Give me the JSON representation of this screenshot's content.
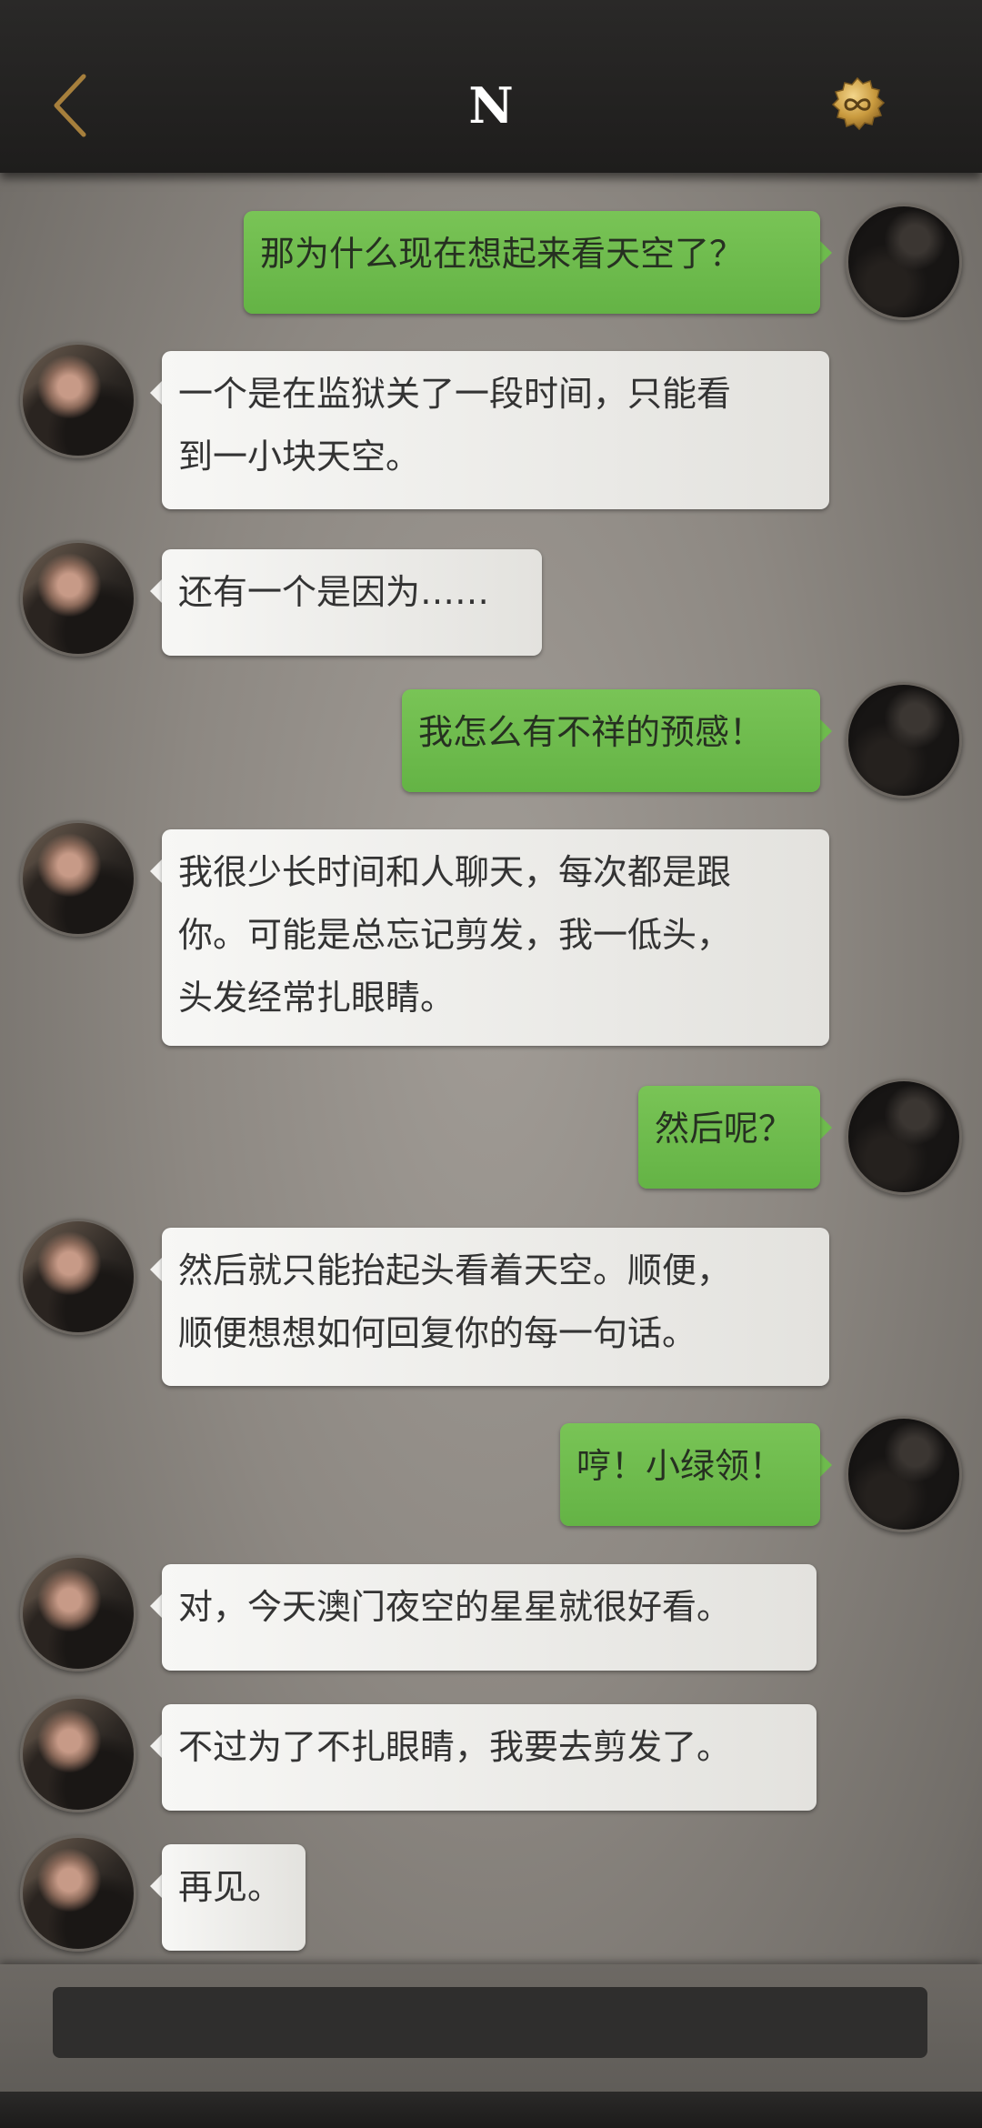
{
  "header": {
    "title": "N",
    "back_icon": "chevron-left-icon",
    "badge_icon": "infinity-badge-icon",
    "accent_color": "#a67f3c"
  },
  "messages": [
    {
      "side": "right",
      "text": "那为什么现在想起来看天空了？"
    },
    {
      "side": "left",
      "text": "一个是在监狱关了一段时间，只能看\n到一小块天空。"
    },
    {
      "side": "left",
      "text": "还有一个是因为……"
    },
    {
      "side": "right",
      "text": "我怎么有不祥的预感！"
    },
    {
      "side": "left",
      "text": "我很少长时间和人聊天，每次都是跟\n你。可能是总忘记剪发，我一低头，\n头发经常扎眼睛。"
    },
    {
      "side": "right",
      "text": "然后呢？"
    },
    {
      "side": "left",
      "text": "然后就只能抬起头看着天空。顺便，\n顺便想想如何回复你的每一句话。"
    },
    {
      "side": "right",
      "text": "哼！小绿领！"
    },
    {
      "side": "left",
      "text": "对，今天澳门夜空的星星就很好看。"
    },
    {
      "side": "left",
      "text": "不过为了不扎眼睛，我要去剪发了。"
    },
    {
      "side": "left",
      "text": "再见。"
    }
  ],
  "input": {
    "value": "",
    "placeholder": ""
  },
  "colors": {
    "sent_bubble": "#6ebb4d",
    "received_bubble": "#f1f0ee",
    "header_bg": "#232221"
  }
}
